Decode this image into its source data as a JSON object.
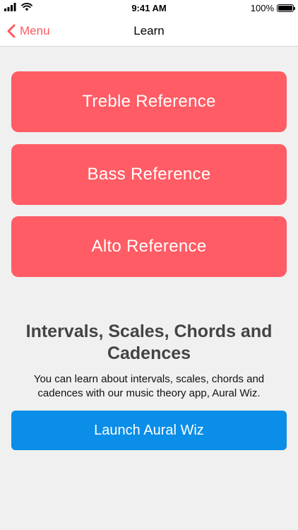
{
  "status_bar": {
    "time": "9:41 AM",
    "battery_percent": "100%",
    "icons": [
      "signal-icon",
      "wifi-icon",
      "battery-icon"
    ]
  },
  "nav": {
    "back_label": "Menu",
    "back_icon": "chevron-left-icon",
    "title": "Learn"
  },
  "references": {
    "treble": "Treble Reference",
    "bass": "Bass Reference",
    "alto": "Alto Reference"
  },
  "promo": {
    "heading": "Intervals, Scales, Chords and Cadences",
    "description": "You can learn about intervals, scales, chords and cadences with our music theory app, Aural Wiz.",
    "button_label": "Launch Aural Wiz"
  },
  "colors": {
    "accent_red": "#ff5c65",
    "accent_blue": "#0a8ee8",
    "back_text": "#ff5a5f",
    "background": "#f0f0f0"
  }
}
